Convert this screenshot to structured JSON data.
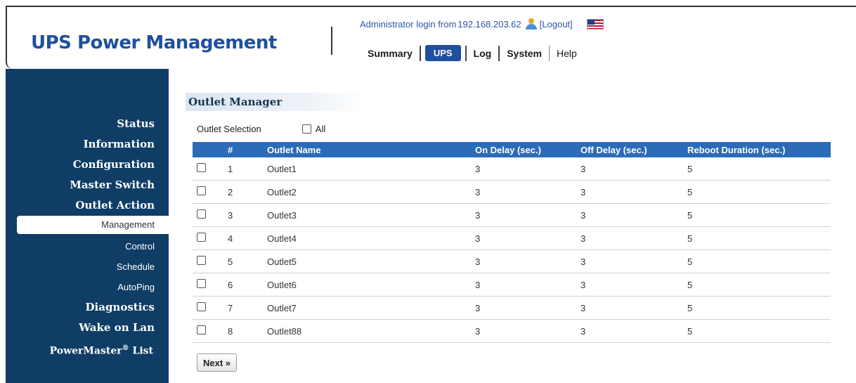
{
  "header": {
    "brand": "UPS Power Management",
    "login_prefix": "Administrator login from",
    "login_ip": "192.168.203.62",
    "logout_label": "[Logout]",
    "icons": {
      "user": "user-icon",
      "flag": "us-flag-icon"
    }
  },
  "topnav": {
    "summary": "Summary",
    "ups": "UPS",
    "log": "Log",
    "system": "System",
    "help": "Help",
    "active": "UPS"
  },
  "sidebar": {
    "status": "Status",
    "information": "Information",
    "configuration": "Configuration",
    "master_switch": "Master Switch",
    "outlet_action": "Outlet Action",
    "management": "Management",
    "control": "Control",
    "schedule": "Schedule",
    "autoping": "AutoPing",
    "diagnostics": "Diagnostics",
    "wake_on_lan": "Wake on Lan",
    "powermaster": "PowerMaster",
    "powermaster_mark": "®",
    "powermaster_suffix": " List",
    "selected": "Management"
  },
  "main": {
    "title": "Outlet Manager",
    "selection_label": "Outlet Selection",
    "all_label": "All",
    "next_label": "Next »"
  },
  "table": {
    "headers": {
      "num": "#",
      "name": "Outlet Name",
      "on_delay": "On Delay (sec.)",
      "off_delay": "Off Delay (sec.)",
      "reboot": "Reboot Duration (sec.)"
    },
    "rows": [
      {
        "num": "1",
        "name": "Outlet1",
        "on": "3",
        "off": "3",
        "reboot": "5"
      },
      {
        "num": "2",
        "name": "Outlet2",
        "on": "3",
        "off": "3",
        "reboot": "5"
      },
      {
        "num": "3",
        "name": "Outlet3",
        "on": "3",
        "off": "3",
        "reboot": "5"
      },
      {
        "num": "4",
        "name": "Outlet4",
        "on": "3",
        "off": "3",
        "reboot": "5"
      },
      {
        "num": "5",
        "name": "Outlet5",
        "on": "3",
        "off": "3",
        "reboot": "5"
      },
      {
        "num": "6",
        "name": "Outlet6",
        "on": "3",
        "off": "3",
        "reboot": "5"
      },
      {
        "num": "7",
        "name": "Outlet7",
        "on": "3",
        "off": "3",
        "reboot": "5"
      },
      {
        "num": "8",
        "name": "Outlet88",
        "on": "3",
        "off": "3",
        "reboot": "5"
      }
    ]
  },
  "colors": {
    "brand": "#1f4f9e",
    "sidebar_bg": "#0f3d66",
    "table_header": "#2c6bb8",
    "link": "#2a56a8"
  }
}
